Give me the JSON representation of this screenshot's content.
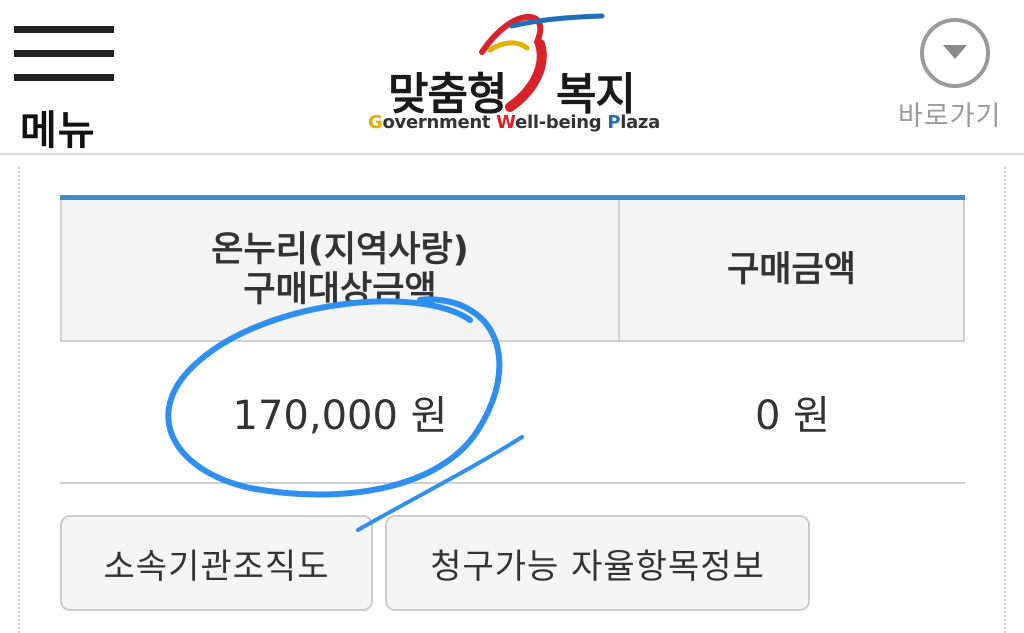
{
  "header": {
    "menu_label": "메뉴",
    "logo": {
      "word1": "맞춤형",
      "word2": "복지",
      "sub_g": "G",
      "sub_rest1": "overnment ",
      "sub_w": "W",
      "sub_rest2": "ell-being ",
      "sub_p": "P",
      "sub_rest3": "laza"
    },
    "shortcut_label": "바로가기"
  },
  "table": {
    "headers": [
      "온누리(지역사랑)\n구매대상금액",
      "구매금액"
    ],
    "header1_line1": "온누리(지역사랑)",
    "header1_line2": "구매대상금액",
    "header2": "구매금액",
    "row": {
      "eligible_amount": "170,000 원",
      "purchase_amount": "0 원"
    }
  },
  "buttons": {
    "org_chart": "소속기관조직도",
    "claimable_items": "청구가능 자율항목정보"
  },
  "colors": {
    "table_accent": "#3d8ccc",
    "annotation_blue": "#2f8ff0",
    "logo_red": "#d8232a",
    "logo_blue": "#1e6fb8",
    "logo_yellow": "#e0b000"
  },
  "icons": [
    "hamburger-menu-icon",
    "dropdown-circle-icon"
  ]
}
